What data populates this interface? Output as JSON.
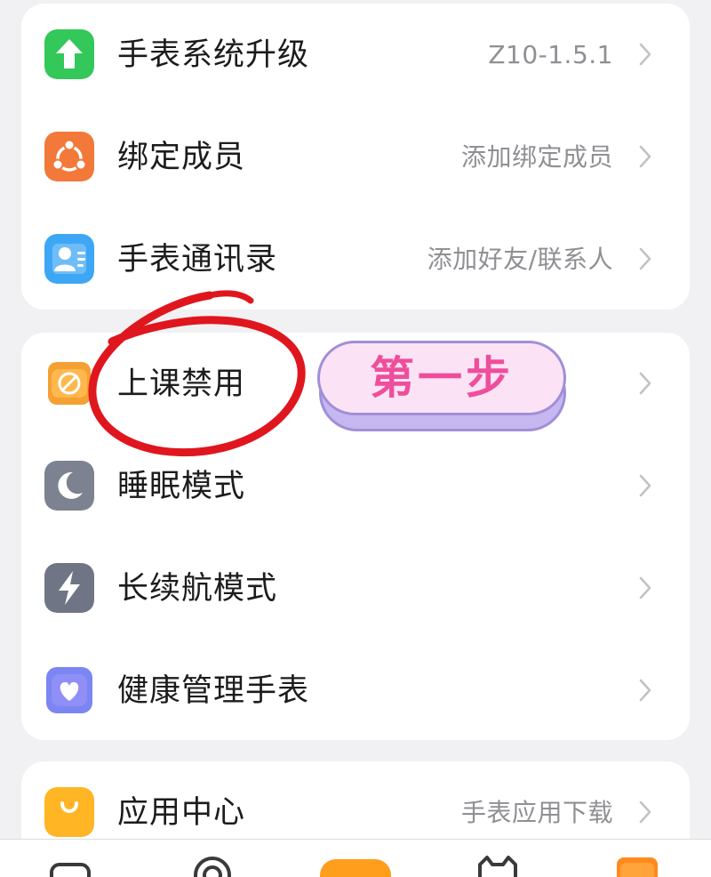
{
  "settings_groups": [
    {
      "items": [
        {
          "title": "手表系统升级",
          "value": "Z10-1.5.1",
          "icon": "upload-arrow-icon",
          "color": "#34c759"
        },
        {
          "title": "绑定成员",
          "value": "添加绑定成员",
          "icon": "members-icon",
          "color": "#f2793a"
        },
        {
          "title": "手表通讯录",
          "value": "添加好友/联系人",
          "icon": "contacts-icon",
          "color": "#3ea7f5"
        }
      ]
    },
    {
      "items": [
        {
          "title": "上课禁用",
          "value": "",
          "icon": "class-disable-icon",
          "color": "#f5a033"
        },
        {
          "title": "睡眠模式",
          "value": "",
          "icon": "moon-icon",
          "color": "#7d8290"
        },
        {
          "title": "长续航模式",
          "value": "",
          "icon": "lightning-icon",
          "color": "#707586"
        },
        {
          "title": "健康管理手表",
          "value": "",
          "icon": "health-heart-icon",
          "color": "#7b86f2"
        }
      ]
    },
    {
      "items": [
        {
          "title": "应用中心",
          "value": "手表应用下载",
          "icon": "shopping-bag-icon",
          "color": "#ffb524"
        }
      ]
    }
  ],
  "annotation": {
    "step_label": "第一步",
    "circle_color": "#e0161e",
    "pill_text_color": "#ee4e9b"
  },
  "bottom_tabs": [
    {
      "icon": "message-tab-icon"
    },
    {
      "icon": "location-tab-icon"
    },
    {
      "icon": "watch-tab-icon"
    },
    {
      "icon": "pet-tab-icon"
    },
    {
      "icon": "profile-tab-icon"
    }
  ]
}
